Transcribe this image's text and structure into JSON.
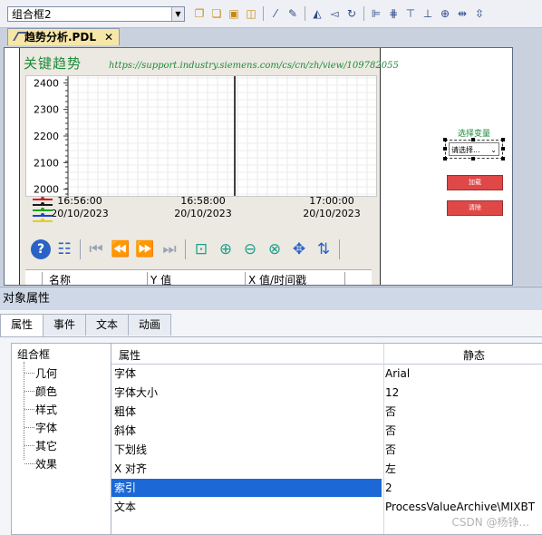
{
  "toolbar": {
    "object_combo": "组合框2",
    "icons": [
      "group-icon",
      "ungroup-icon",
      "bring-front-icon",
      "send-back-icon",
      "magic-wand-icon",
      "dropper-icon",
      "flip-horizontal-icon",
      "flip-vertical-icon",
      "rotate-icon",
      "align-left-icon",
      "align-center-icon",
      "align-right-icon",
      "align-top-icon",
      "align-bottom-icon",
      "distribute-h-icon",
      "distribute-v-icon"
    ]
  },
  "editor": {
    "tab_label": "趋势分析.PDL",
    "tab_close": "✕",
    "trend": {
      "title": "关键趋势",
      "url": "https://support.industry.siemens.com/cs/cn/zh/view/109782055",
      "table_headers": [
        "名称",
        "Y 值",
        "X 值/时间戳"
      ]
    },
    "select_label": "选择变量",
    "select_value": "请选择...",
    "load_button": "加载",
    "clear_button": "清除"
  },
  "chart_data": {
    "type": "line",
    "y_ticks": [
      "2400",
      "2300",
      "2200",
      "2100",
      "2000"
    ],
    "x_ticks": [
      {
        "time": "16:56:00",
        "date": "20/10/2023"
      },
      {
        "time": "16:58:00",
        "date": "20/10/2023"
      },
      {
        "time": "17:00:00",
        "date": "20/10/2023"
      }
    ],
    "series": [],
    "legend_colors": [
      "#d42020",
      "#1a1a1a",
      "#20a020",
      "#2040d0",
      "#e0d020"
    ],
    "grid": true,
    "cursor_time": "16:58:00"
  },
  "props": {
    "header": "对象属性",
    "tabs": [
      "属性",
      "事件",
      "文本",
      "动画"
    ],
    "active_tab": 0,
    "tree_root": "组合框",
    "tree_items": [
      "几何",
      "颜色",
      "样式",
      "字体",
      "其它",
      "效果"
    ],
    "grid_header_property": "属性",
    "grid_header_static": "静态",
    "rows": [
      {
        "name": "字体",
        "value": "Arial"
      },
      {
        "name": "字体大小",
        "value": "12"
      },
      {
        "name": "粗体",
        "value": "否"
      },
      {
        "name": "斜体",
        "value": "否"
      },
      {
        "name": "下划线",
        "value": "否"
      },
      {
        "name": "X 对齐",
        "value": "左"
      },
      {
        "name": "索引",
        "value": "2"
      },
      {
        "name": "文本",
        "value": "ProcessValueArchive\\MIXBT"
      }
    ],
    "selected_row": 6
  },
  "watermark": "CSDN @杨铮..."
}
